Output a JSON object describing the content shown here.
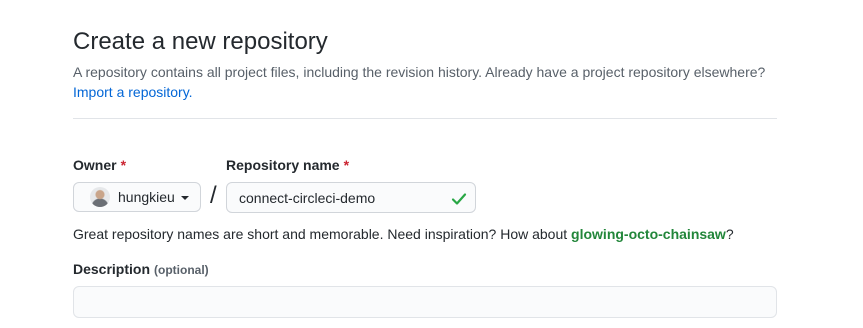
{
  "header": {
    "title": "Create a new repository",
    "subtitle": "A repository contains all project files, including the revision history. Already have a project repository elsewhere?",
    "import_link": "Import a repository."
  },
  "owner": {
    "label": "Owner",
    "required_mark": "*",
    "value": "hungkieu"
  },
  "separator": "/",
  "repository": {
    "label": "Repository name",
    "required_mark": "*",
    "value": "connect-circleci-demo",
    "valid_icon": "check-icon",
    "valid_color": "#28a745"
  },
  "hint": {
    "prefix": "Great repository names are short and memorable. Need inspiration? How about ",
    "suggestion": "glowing-octo-chainsaw",
    "suffix": "?"
  },
  "description": {
    "label": "Description",
    "optional": "(optional)",
    "value": ""
  },
  "colors": {
    "link": "#0366d6",
    "required": "#cb2431",
    "suggestion": "#22863a"
  }
}
